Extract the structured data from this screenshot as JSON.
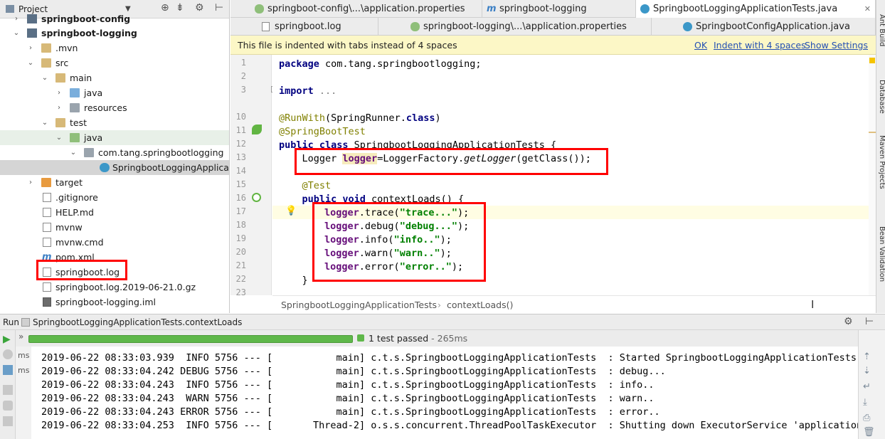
{
  "project": {
    "title": "Project",
    "tree": [
      {
        "label": "springboot-config",
        "bold": true
      },
      {
        "label": "springboot-logging",
        "bold": true
      },
      {
        "label": ".mvn"
      },
      {
        "label": "src"
      },
      {
        "label": "main"
      },
      {
        "label": "java"
      },
      {
        "label": "resources"
      },
      {
        "label": "test"
      },
      {
        "label": "java"
      },
      {
        "label": "com.tang.springbootlogging"
      },
      {
        "label": "SpringbootLoggingApplicationTests"
      },
      {
        "label": "target"
      },
      {
        "label": ".gitignore"
      },
      {
        "label": "HELP.md"
      },
      {
        "label": "mvnw"
      },
      {
        "label": "mvnw.cmd"
      },
      {
        "label": "pom.xml"
      },
      {
        "label": "springboot.log"
      },
      {
        "label": "springboot.log.2019-06-21.0.gz"
      },
      {
        "label": "springboot-logging.iml"
      }
    ]
  },
  "side_tabs": [
    "Ant Build",
    "Database",
    "Maven Projects",
    "Bean Validation"
  ],
  "tabs_row1": [
    {
      "label": "springboot-config\\...\\application.properties"
    },
    {
      "label": "springboot-logging"
    },
    {
      "label": "SpringbootLoggingApplicationTests.java"
    }
  ],
  "tabs_row2": [
    {
      "label": "springboot.log"
    },
    {
      "label": "springboot-logging\\...\\application.properties"
    },
    {
      "label": "SpringbootConfigApplication.java"
    }
  ],
  "notice": {
    "message": "This file is indented with tabs instead of 4 spaces",
    "ok": "OK",
    "indent": "Indent with 4 spaces",
    "settings": "Show Settings"
  },
  "editor": {
    "line_numbers": [
      "1",
      "2",
      "3",
      "10",
      "11",
      "12",
      "13",
      "14",
      "15",
      "16",
      "17",
      "18",
      "19",
      "20",
      "21",
      "22",
      "23"
    ],
    "breadcrumb": [
      "SpringbootLoggingApplicationTests",
      "contextLoads()"
    ]
  },
  "code": {
    "l1_kw": "package",
    "l1_rest": " com.tang.springbootlogging;",
    "l3_kw": "import",
    "l3_rest": " ...",
    "l10_an": "@RunWith",
    "l10_a": "(SpringRunner.",
    "l10_kw": "class",
    "l10_b": ")",
    "l11_an": "@SpringBootTest",
    "l12_kw": "public class",
    "l12_rest": " SpringbootLoggingApplicationTests {",
    "l13_a": "    Logger ",
    "l13_fld": "logger",
    "l13_b": "=LoggerFactory.",
    "l13_it": "getLogger",
    "l13_c": "(getClass());",
    "l15_an": "    @Test",
    "l16_kw": "    public void",
    "l16_rest": " contextLoads() {",
    "l17_fld": "logger",
    "l17_a": ".trace(",
    "l17_str": "\"trace...\"",
    "l17_b": ");",
    "l18_fld": "logger",
    "l18_a": ".debug(",
    "l18_str": "\"debug...\"",
    "l18_b": ");",
    "l19_fld": "logger",
    "l19_a": ".info(",
    "l19_str": "\"info..\"",
    "l19_b": ");",
    "l20_fld": "logger",
    "l20_a": ".warn(",
    "l20_str": "\"warn..\"",
    "l20_b": ");",
    "l21_fld": "logger",
    "l21_a": ".error(",
    "l21_str": "\"error..\"",
    "l21_b": ");",
    "l22": "    }"
  },
  "run": {
    "label": "Run",
    "config": "SpringbootLoggingApplicationTests.contextLoads",
    "result": "1 test passed",
    "duration": " - 265ms",
    "progress": 1.0,
    "tree_labels": [
      "ms",
      "ms"
    ],
    "log_lines": [
      "2019-06-22 08:33:03.939  INFO 5756 --- [           main] c.t.s.SpringbootLoggingApplicationTests  : Started SpringbootLoggingApplicationTests in",
      "2019-06-22 08:33:04.242 DEBUG 5756 --- [           main] c.t.s.SpringbootLoggingApplicationTests  : debug...",
      "2019-06-22 08:33:04.243  INFO 5756 --- [           main] c.t.s.SpringbootLoggingApplicationTests  : info..",
      "2019-06-22 08:33:04.243  WARN 5756 --- [           main] c.t.s.SpringbootLoggingApplicationTests  : warn..",
      "2019-06-22 08:33:04.243 ERROR 5756 --- [           main] c.t.s.SpringbootLoggingApplicationTests  : error..",
      "2019-06-22 08:33:04.253  INFO 5756 --- [       Thread-2] o.s.s.concurrent.ThreadPoolTaskExecutor  : Shutting down ExecutorService 'applicationTa"
    ]
  },
  "colors": {
    "annotation": "#ff0000",
    "keyword": "#000080",
    "string": "#008000",
    "annotation_code": "#808000",
    "field": "#660e7a",
    "progress": "#5fb84a"
  }
}
